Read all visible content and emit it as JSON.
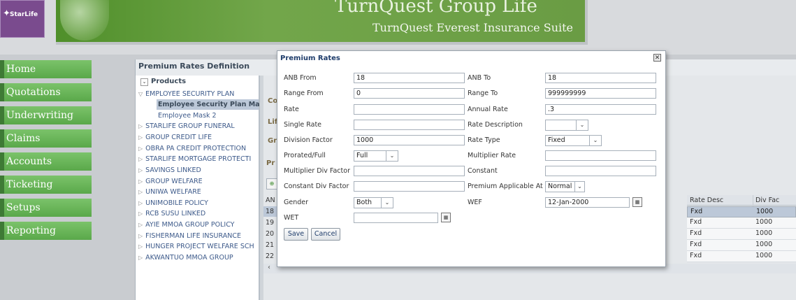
{
  "header": {
    "logo_text": "StarLife",
    "app_title": "TurnQuest Group Life",
    "app_subtitle": "TurnQuest Everest Insurance Suite"
  },
  "nav": {
    "items": [
      "Home",
      "Quotations",
      "Underwriting",
      "Claims",
      "Accounts",
      "Ticketing",
      "Setups",
      "Reporting"
    ]
  },
  "panel": {
    "title": "Premium Rates Definition",
    "products_header": "Products",
    "tree": [
      "EMPLOYEE SECURITY PLAN",
      "Employee Security Plan Mas",
      "Employee Mask 2",
      "STARLIFE GROUP FUNERAL",
      "GROUP CREDIT LIFE",
      "OBRA PA CREDIT PROTECTION",
      "STARLIFE MORTGAGE PROTECTI",
      "SAVINGS LINKED",
      "GROUP WELFARE",
      "UNIWA WELFARE",
      "UNIMOBILE POLICY",
      "RCB SUSU LINKED",
      "AYIE MMOA GROUP POLICY",
      "FISHERMAN LIFE INSURANCE",
      "HUNGER PROJECT WELFARE SCH",
      "AKWANTUO MMOA GROUP"
    ],
    "right_labels": [
      "Co",
      "Lif",
      "Gr",
      "Pr"
    ],
    "grid": {
      "row_num_header": "AN",
      "row_nums": [
        "18",
        "19",
        "20",
        "21",
        "22"
      ],
      "headers": [
        "Rate Desc",
        "Div Fac"
      ],
      "rows": [
        [
          "Fxd",
          "1000"
        ],
        [
          "Fxd",
          "1000"
        ],
        [
          "Fxd",
          "1000"
        ],
        [
          "Fxd",
          "1000"
        ],
        [
          "Fxd",
          "1000"
        ]
      ]
    }
  },
  "dialog": {
    "title": "Premium Rates",
    "anb_from_label": "ANB From",
    "anb_from": "18",
    "anb_to_label": "ANB To",
    "anb_to": "18",
    "range_from_label": "Range From",
    "range_from": "0",
    "range_to_label": "Range To",
    "range_to": "999999999",
    "rate_label": "Rate",
    "rate": "",
    "annual_rate_label": "Annual Rate",
    "annual_rate": ".3",
    "single_rate_label": "Single Rate",
    "single_rate": "",
    "rate_desc_label": "Rate Description",
    "rate_desc": "",
    "division_factor_label": "Division Factor",
    "division_factor": "1000",
    "rate_type_label": "Rate Type",
    "rate_type": "Fixed",
    "prorated_label": "Prorated/Full",
    "prorated": "Full",
    "multiplier_rate_label": "Multiplier Rate",
    "multiplier_rate": "",
    "multiplier_div_label": "Multiplier Div Factor",
    "multiplier_div": "",
    "constant_label": "Constant",
    "constant": "",
    "constant_div_label": "Constant Div Factor",
    "constant_div": "",
    "premium_applicable_label": "Premium Applicable At",
    "premium_applicable": "Normal",
    "gender_label": "Gender",
    "gender": "Both",
    "wef_label": "WEF",
    "wef": "12-Jan-2000",
    "wet_label": "WET",
    "wet": "",
    "save_label": "Save",
    "cancel_label": "Cancel"
  }
}
